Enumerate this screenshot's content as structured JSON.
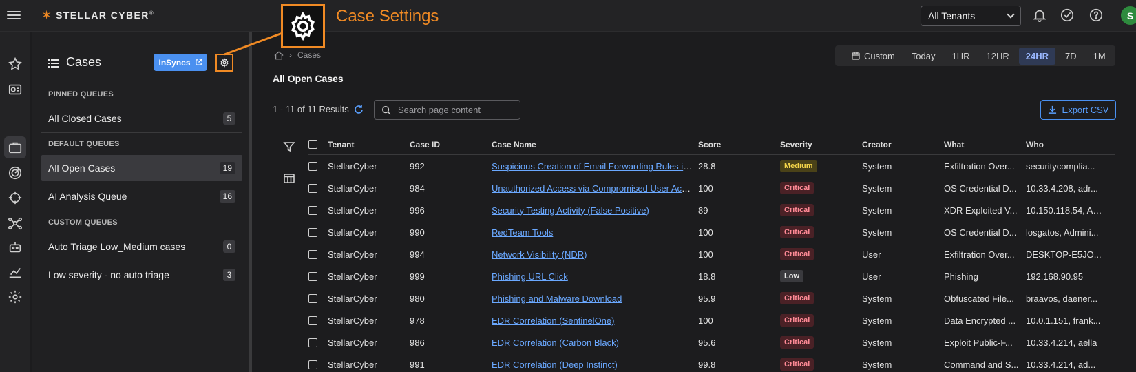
{
  "brand": {
    "name": "STELLAR CYBER",
    "mark": "®"
  },
  "header": {
    "tenant_select": "All Tenants",
    "avatar_initial": "S"
  },
  "callout": {
    "title": "Case Settings"
  },
  "panel": {
    "title": "Cases",
    "insyncs_label": "InSyncs",
    "sections": {
      "pinned": "PINNED QUEUES",
      "default": "DEFAULT QUEUES",
      "custom": "CUSTOM QUEUES"
    },
    "queues": [
      {
        "label": "All Closed Cases",
        "count": "5"
      },
      {
        "label": "All Open Cases",
        "count": "19"
      },
      {
        "label": "AI Analysis Queue",
        "count": "16"
      },
      {
        "label": "Auto Triage Low_Medium cases",
        "count": "0"
      },
      {
        "label": "Low severity - no auto triage",
        "count": "3"
      }
    ]
  },
  "breadcrumb": {
    "current": "Cases"
  },
  "timebar": {
    "custom": "Custom",
    "options": [
      "Today",
      "1HR",
      "12HR",
      "24HR",
      "7D",
      "1M"
    ],
    "active": "24HR"
  },
  "main": {
    "heading": "All Open Cases",
    "results": "1 - 11 of 11 Results",
    "search_placeholder": "Search page content",
    "export_label": "Export CSV"
  },
  "table": {
    "headers": [
      "Tenant",
      "Case ID",
      "Case Name",
      "Score",
      "Severity",
      "Creator",
      "What",
      "Who"
    ],
    "rows": [
      {
        "tenant": "StellarCyber",
        "id": "992",
        "name": "Suspicious Creation of Email Forwarding Rules in O",
        "score": "28.8",
        "severity": "Medium",
        "creator": "System",
        "what": "Exfiltration Over...",
        "who": "securitycomplia..."
      },
      {
        "tenant": "StellarCyber",
        "id": "984",
        "name": "Unauthorized Access via Compromised User Accou",
        "score": "100",
        "severity": "Critical",
        "creator": "System",
        "what": "OS Credential D...",
        "who": "10.33.4.208, adr..."
      },
      {
        "tenant": "StellarCyber",
        "id": "996",
        "name": "Security Testing Activity (False Positive)",
        "score": "89",
        "severity": "Critical",
        "creator": "System",
        "what": "XDR Exploited V...",
        "who": "10.150.118.54, Ad..."
      },
      {
        "tenant": "StellarCyber",
        "id": "990",
        "name": "RedTeam Tools",
        "score": "100",
        "severity": "Critical",
        "creator": "System",
        "what": "OS Credential D...",
        "who": "losgatos, Admini..."
      },
      {
        "tenant": "StellarCyber",
        "id": "994",
        "name": "Network Visibility (NDR)",
        "score": "100",
        "severity": "Critical",
        "creator": "User",
        "what": "Exfiltration Over...",
        "who": "DESKTOP-E5JO..."
      },
      {
        "tenant": "StellarCyber",
        "id": "999",
        "name": "Phishing URL Click",
        "score": "18.8",
        "severity": "Low",
        "creator": "User",
        "what": "Phishing",
        "who": "192.168.90.95"
      },
      {
        "tenant": "StellarCyber",
        "id": "980",
        "name": "Phishing and Malware Download",
        "score": "95.9",
        "severity": "Critical",
        "creator": "System",
        "what": "Obfuscated File...",
        "who": "braavos, daener..."
      },
      {
        "tenant": "StellarCyber",
        "id": "978",
        "name": "EDR Correlation (SentinelOne)",
        "score": "100",
        "severity": "Critical",
        "creator": "System",
        "what": "Data Encrypted ...",
        "who": "10.0.1.151, frank..."
      },
      {
        "tenant": "StellarCyber",
        "id": "986",
        "name": "EDR Correlation (Carbon Black)",
        "score": "95.6",
        "severity": "Critical",
        "creator": "System",
        "what": "Exploit Public-F...",
        "who": "10.33.4.214, aella"
      },
      {
        "tenant": "StellarCyber",
        "id": "991",
        "name": "EDR Correlation (Deep Instinct)",
        "score": "99.8",
        "severity": "Critical",
        "creator": "System",
        "what": "Command and S...",
        "who": "10.33.4.214, ad..."
      }
    ]
  },
  "colors": {
    "accent": "#f08a24",
    "link": "#6aa8ff",
    "critical": "#ff8a96",
    "medium": "#f4d54a"
  }
}
